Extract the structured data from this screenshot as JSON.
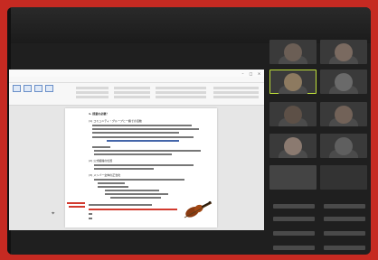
{
  "window": {
    "title": "",
    "search_placeholder": ""
  },
  "ribbon": {
    "tabs": [
      "",
      "",
      "",
      "",
      "",
      "",
      "",
      ""
    ],
    "active_tab_index": 3
  },
  "document": {
    "heading": "1. 授業の必要？",
    "section_a": "(1) コミュニティ・グループと一緒での活動",
    "section_b": "(2) 公式組織の位置",
    "section_c": "(3) メンバー全体の正当化",
    "red_note": "",
    "page_footer": ""
  },
  "colors": {
    "frame": "#c62a22",
    "doc_background": "#ffffff",
    "accent": "#2b5797",
    "share_button": "#e04a2e",
    "active_tile": "#bfe03a"
  },
  "participants": [
    {
      "name": ""
    },
    {
      "name": ""
    },
    {
      "name": ""
    },
    {
      "name": ""
    },
    {
      "name": ""
    },
    {
      "name": ""
    },
    {
      "name": ""
    },
    {
      "name": ""
    },
    {
      "name": ""
    },
    {
      "name": ""
    },
    {
      "name": ""
    },
    {
      "name": ""
    }
  ]
}
